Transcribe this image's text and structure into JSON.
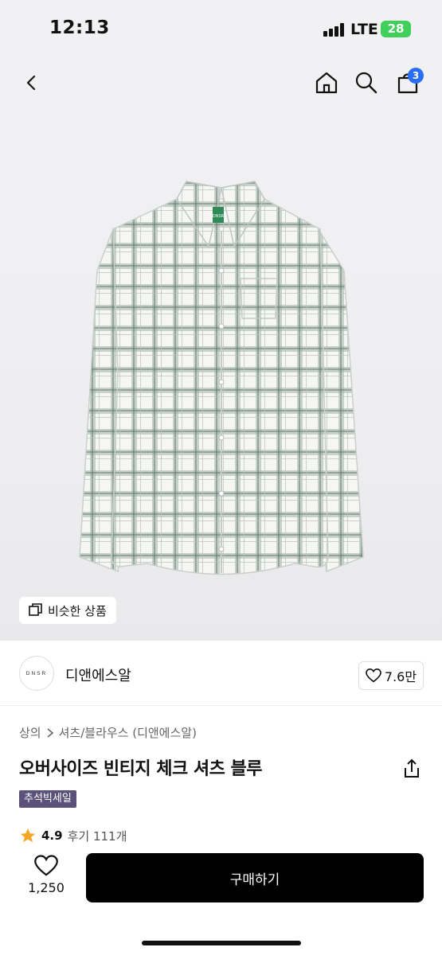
{
  "status_bar": {
    "time": "12:13",
    "network": "LTE",
    "battery": "28"
  },
  "nav": {
    "cart_count": "3"
  },
  "product_image": {
    "logo_mark": "DNSR",
    "similar_label": "비슷한 상품"
  },
  "brand": {
    "logo_text": "DNSR",
    "name": "디앤에스알",
    "likes": "7.6만"
  },
  "breadcrumb": {
    "category": "상의",
    "subcategory": "셔츠/블라우스 (디앤에스알)"
  },
  "product": {
    "title": "오버사이즈 빈티지 체크 셔츠 블루",
    "promo_tag": "추석빅세일",
    "rating": "4.9",
    "reviews": "후기 111개"
  },
  "bottom_bar": {
    "wish_count": "1,250",
    "buy_label": "구매하기"
  },
  "colors": {
    "badge": "#2b6ef6",
    "promo": "#5a5278",
    "star": "#f5a623",
    "shirt_green": "#8fa79a"
  }
}
